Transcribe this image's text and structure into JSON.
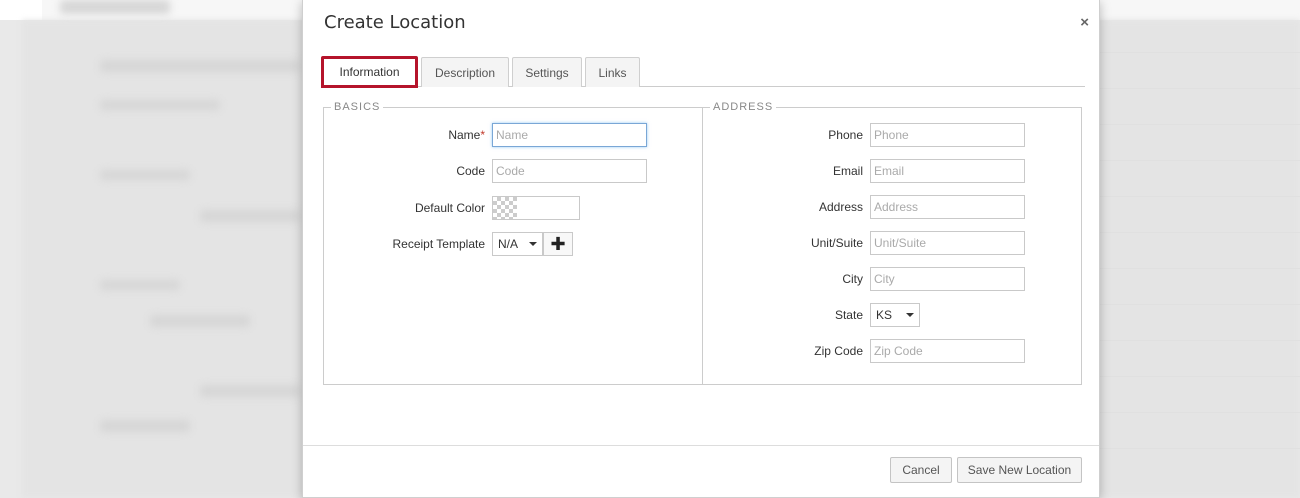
{
  "modal": {
    "title": "Create Location",
    "close_glyph": "×"
  },
  "tabs": [
    {
      "label": "Information",
      "active": true
    },
    {
      "label": "Description",
      "active": false
    },
    {
      "label": "Settings",
      "active": false
    },
    {
      "label": "Links",
      "active": false
    }
  ],
  "basics": {
    "legend": "BASICS",
    "name": {
      "label": "Name",
      "required_mark": "*",
      "placeholder": "Name"
    },
    "code": {
      "label": "Code",
      "placeholder": "Code"
    },
    "default_color": {
      "label": "Default Color"
    },
    "receipt_template": {
      "label": "Receipt Template",
      "selected": "N/A",
      "add_glyph": "✚"
    }
  },
  "address": {
    "legend": "ADDRESS",
    "phone": {
      "label": "Phone",
      "placeholder": "Phone"
    },
    "email": {
      "label": "Email",
      "placeholder": "Email"
    },
    "address": {
      "label": "Address",
      "placeholder": "Address"
    },
    "unit_suite": {
      "label": "Unit/Suite",
      "placeholder": "Unit/Suite"
    },
    "city": {
      "label": "City",
      "placeholder": "City"
    },
    "state": {
      "label": "State",
      "selected": "KS"
    },
    "zip_code": {
      "label": "Zip Code",
      "placeholder": "Zip Code"
    }
  },
  "footer": {
    "cancel_label": "Cancel",
    "save_label": "Save New Location"
  },
  "colors": {
    "active_tab_border": "#b5142b",
    "focus_border": "#7aa7d6",
    "required": "#c0392b"
  }
}
